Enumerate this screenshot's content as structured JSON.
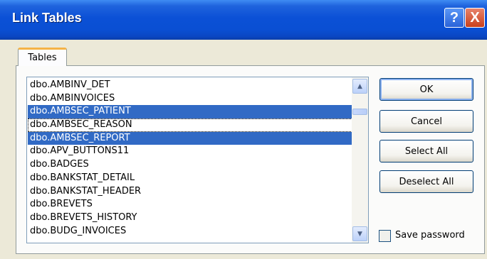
{
  "window": {
    "title": "Link Tables"
  },
  "titlebar": {
    "help_glyph": "?",
    "close_glyph": "X"
  },
  "tabs": [
    {
      "label": "Tables"
    }
  ],
  "table_list": {
    "items": [
      {
        "label": "dbo.AMBINV_DET",
        "selected": false,
        "focused": false
      },
      {
        "label": "dbo.AMBINVOICES",
        "selected": false,
        "focused": false
      },
      {
        "label": "dbo.AMBSEC_PATIENT",
        "selected": true,
        "focused": false
      },
      {
        "label": "dbo.AMBSEC_REASON",
        "selected": false,
        "focused": true
      },
      {
        "label": "dbo.AMBSEC_REPORT",
        "selected": true,
        "focused": false
      },
      {
        "label": "dbo.APV_BUTTONS11",
        "selected": false,
        "focused": false
      },
      {
        "label": "dbo.BADGES",
        "selected": false,
        "focused": false
      },
      {
        "label": "dbo.BANKSTAT_DETAIL",
        "selected": false,
        "focused": false
      },
      {
        "label": "dbo.BANKSTAT_HEADER",
        "selected": false,
        "focused": false
      },
      {
        "label": "dbo.BREVETS",
        "selected": false,
        "focused": false
      },
      {
        "label": "dbo.BREVETS_HISTORY",
        "selected": false,
        "focused": false
      },
      {
        "label": "dbo.BUDG_INVOICES",
        "selected": false,
        "focused": false
      }
    ]
  },
  "buttons": {
    "ok": "OK",
    "cancel": "Cancel",
    "select_all": "Select All",
    "deselect_all": "Deselect All"
  },
  "save_password": {
    "label": "Save password",
    "checked": false
  },
  "icons": {
    "scroll_up": "scroll-up-arrow-icon",
    "scroll_down": "scroll-down-arrow-icon"
  },
  "colors": {
    "titlebar": "#0a50d6",
    "selection": "#316ac5",
    "tab_highlight": "#f5b347",
    "close_button": "#c9401d"
  }
}
